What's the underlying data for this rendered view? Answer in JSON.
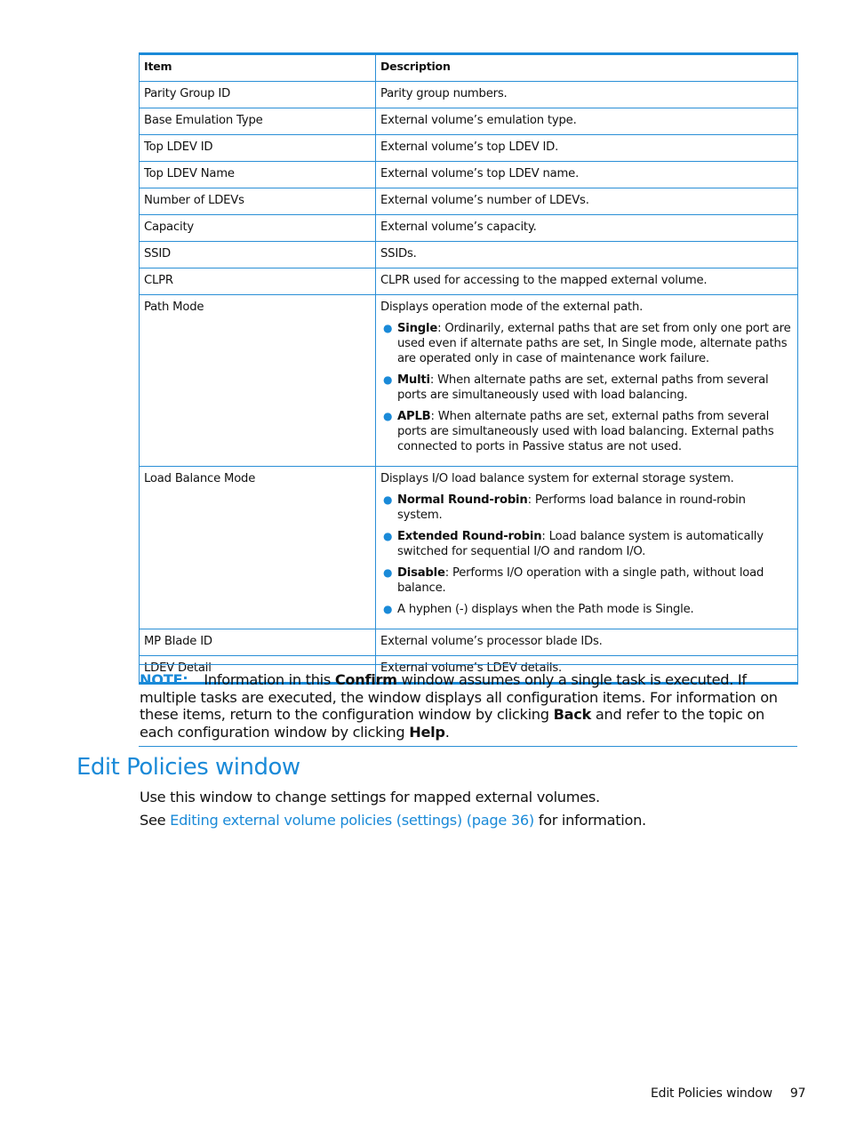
{
  "table": {
    "headers": [
      "Item",
      "Description"
    ],
    "rows": [
      {
        "item": "Parity Group ID",
        "description": "Parity group numbers."
      },
      {
        "item": "Base Emulation Type",
        "description": "External volume’s emulation type."
      },
      {
        "item": "Top LDEV ID",
        "description": "External volume’s top LDEV ID."
      },
      {
        "item": "Top LDEV Name",
        "description": "External volume’s top LDEV name."
      },
      {
        "item": "Number of LDEVs",
        "description": "External volume’s number of LDEVs."
      },
      {
        "item": "Capacity",
        "description": "External volume’s capacity."
      },
      {
        "item": "SSID",
        "description": "SSIDs."
      },
      {
        "item": "CLPR",
        "description": "CLPR used for accessing to the mapped external volume."
      },
      {
        "item": "Path Mode",
        "description": "Displays operation mode of the external path.",
        "bullets": [
          {
            "term": "Single",
            "text": ": Ordinarily, external paths that are set from only one port are used even if alternate paths are set, In Single mode, alternate paths are operated only in case of maintenance work failure."
          },
          {
            "term": "Multi",
            "text": ": When alternate paths are set, external paths from several ports are simultaneously used with load balancing."
          },
          {
            "term": "APLB",
            "text": ": When alternate paths are set, external paths from several ports are simultaneously used with load balancing. External paths connected to ports in Passive status are not used."
          }
        ]
      },
      {
        "item": "Load Balance Mode",
        "description": "Displays I/O load balance system for external storage system.",
        "bullets": [
          {
            "term": "Normal Round-robin",
            "text": ": Performs load balance in round-robin system."
          },
          {
            "term": "Extended Round-robin",
            "text": ": Load balance system is automatically switched for sequential I/O and random I/O."
          },
          {
            "term": "Disable",
            "text": ": Performs I/O operation with a single path, without load balance."
          },
          {
            "term": "",
            "text": "A hyphen (-) displays when the Path mode is Single."
          }
        ]
      },
      {
        "item": "MP Blade ID",
        "description": "External volume’s processor blade IDs."
      },
      {
        "item": "LDEV Detail",
        "description": "External volume’s LDEV details."
      }
    ]
  },
  "note": {
    "label": "NOTE:",
    "t1": "Information in this ",
    "b1": "Confirm",
    "t2": " window assumes only a single task is executed. If multiple tasks are executed, the window displays all configuration items. For information on these items, return to the configuration window by clicking ",
    "b2": "Back",
    "t3": " and refer to the topic on each configuration window by clicking ",
    "b3": "Help",
    "t4": "."
  },
  "section": {
    "title": "Edit Policies window",
    "para1": "Use this window to change settings for mapped external volumes.",
    "para2_prefix": "See ",
    "para2_link": "Editing external volume policies (settings) (page 36)",
    "para2_suffix": " for information."
  },
  "footer": {
    "section_name": "Edit Policies window",
    "page_number": "97"
  },
  "colors": {
    "accent": "#1a8ad8",
    "border": "#2a8fd6"
  }
}
